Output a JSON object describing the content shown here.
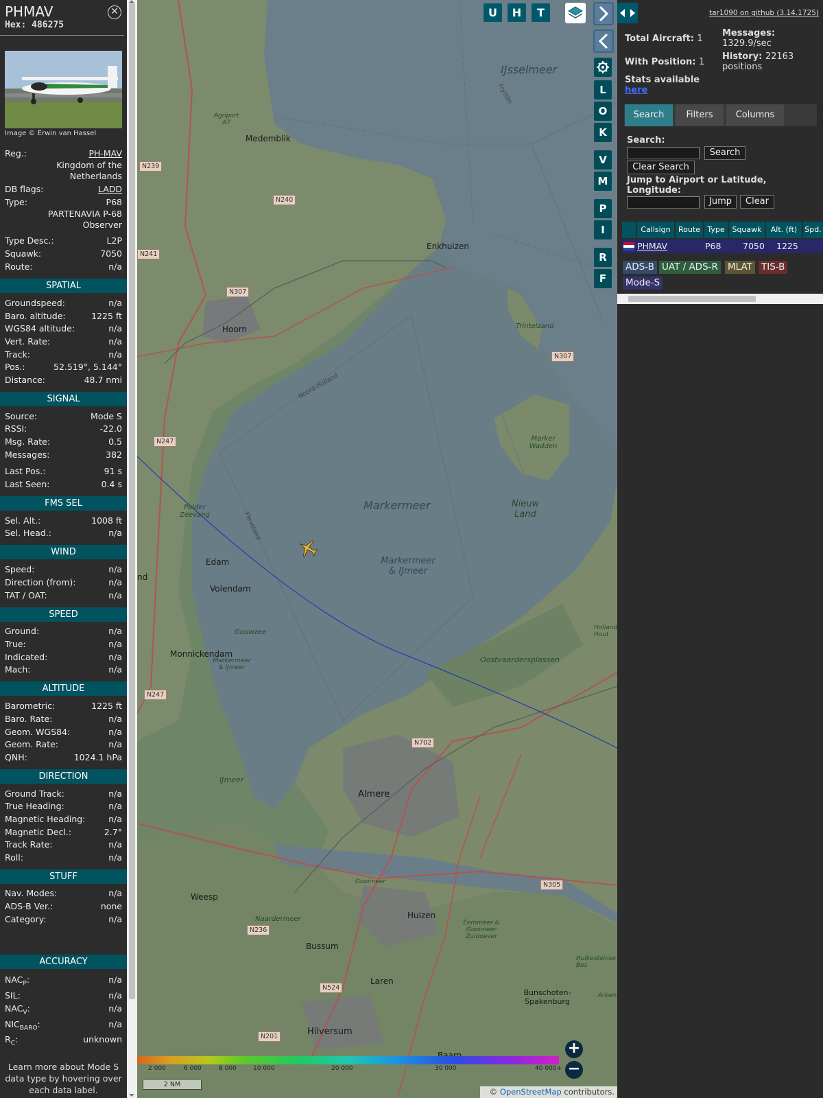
{
  "aircraft": {
    "callsign": "PHMAV",
    "hex_label": "Hex:",
    "hex": "486275",
    "photo_credit": "Image © Erwin van Hassel",
    "reg_label": "Reg.:",
    "reg": "PH-MAV",
    "country": "Kingdom of the Netherlands",
    "dbflags_label": "DB flags:",
    "dbflags": "LADD",
    "type_label": "Type:",
    "type": "P68",
    "type_full": "PARTENAVIA P-68 Observer",
    "typedesc_label": "Type Desc.:",
    "typedesc": "L2P",
    "squawk_label": "Squawk:",
    "squawk": "7050",
    "route_label": "Route:",
    "route": "n/a"
  },
  "spatial": {
    "title": "SPATIAL",
    "rows": [
      {
        "k": "Groundspeed:",
        "v": "n/a"
      },
      {
        "k": "Baro. altitude:",
        "v": "1225 ft"
      },
      {
        "k": "WGS84 altitude:",
        "v": "n/a"
      },
      {
        "k": "Vert. Rate:",
        "v": "n/a"
      },
      {
        "k": "Track:",
        "v": "n/a"
      },
      {
        "k": "Pos.:",
        "v": "52.519°, 5.144°"
      },
      {
        "k": "Distance:",
        "v": "48.7 nmi"
      }
    ]
  },
  "signal": {
    "title": "SIGNAL",
    "rows": [
      {
        "k": "Source:",
        "v": "Mode S"
      },
      {
        "k": "RSSI:",
        "v": "-22.0"
      },
      {
        "k": "Msg. Rate:",
        "v": "0.5"
      },
      {
        "k": "Messages:",
        "v": "382"
      },
      {
        "k": "Last Pos.:",
        "v": "91 s"
      },
      {
        "k": "Last Seen:",
        "v": "0.4 s"
      }
    ]
  },
  "fms": {
    "title": "FMS SEL",
    "rows": [
      {
        "k": "Sel. Alt.:",
        "v": "1008 ft"
      },
      {
        "k": "Sel. Head.:",
        "v": "n/a"
      }
    ]
  },
  "wind": {
    "title": "WIND",
    "rows": [
      {
        "k": "Speed:",
        "v": "n/a"
      },
      {
        "k": "Direction (from):",
        "v": "n/a"
      },
      {
        "k": "TAT / OAT:",
        "v": "n/a"
      }
    ]
  },
  "speed": {
    "title": "SPEED",
    "rows": [
      {
        "k": "Ground:",
        "v": "n/a"
      },
      {
        "k": "True:",
        "v": "n/a"
      },
      {
        "k": "Indicated:",
        "v": "n/a"
      },
      {
        "k": "Mach:",
        "v": "n/a"
      }
    ]
  },
  "altitude": {
    "title": "ALTITUDE",
    "rows": [
      {
        "k": "Barometric:",
        "v": "1225 ft"
      },
      {
        "k": "Baro. Rate:",
        "v": "n/a"
      },
      {
        "k": "Geom. WGS84:",
        "v": "n/a"
      },
      {
        "k": "Geom. Rate:",
        "v": "n/a"
      },
      {
        "k": "QNH:",
        "v": "1024.1 hPa"
      }
    ]
  },
  "direction": {
    "title": "DIRECTION",
    "rows": [
      {
        "k": "Ground Track:",
        "v": "n/a"
      },
      {
        "k": "True Heading:",
        "v": "n/a"
      },
      {
        "k": "Magnetic Heading:",
        "v": "n/a"
      },
      {
        "k": "Magnetic Decl.:",
        "v": "2.7°"
      },
      {
        "k": "Track Rate:",
        "v": "n/a"
      },
      {
        "k": "Roll:",
        "v": "n/a"
      }
    ]
  },
  "stuff": {
    "title": "STUFF",
    "rows": [
      {
        "k": "Nav. Modes:",
        "v": "n/a"
      },
      {
        "k": "ADS-B Ver.:",
        "v": "none"
      },
      {
        "k": "Category:",
        "v": "n/a"
      }
    ]
  },
  "accuracy": {
    "title": "ACCURACY",
    "nacp_main": "NAC",
    "nacp_sub": "P",
    "nacp_v": "n/a",
    "sil_label": "SIL:",
    "sil_v": "n/a",
    "nacv_main": "NAC",
    "nacv_sub": "V",
    "nacv_v": "n/a",
    "nicbaro_main": "NIC",
    "nicbaro_sub": "BARO",
    "nicbaro_v": "n/a",
    "rc_main": "R",
    "rc_sub": "C",
    "rc_v": "unknown",
    "colon": ":"
  },
  "footnote": "Learn more about Mode S data type by hovering over each data label.",
  "map": {
    "top_buttons": [
      "U",
      "H",
      "T"
    ],
    "side_buttons": [
      "L",
      "O",
      "K",
      "V",
      "M",
      "P",
      "I",
      "R",
      "F"
    ],
    "labels": {
      "ijsselmeer": "IJsselmeer",
      "markermeer": "Markermeer",
      "markermeer_ijmeer": "Markermeer & IJmeer",
      "nieuw_land": "Nieuw Land",
      "medemblik": "Medemblik",
      "enkhuizen": "Enkhuizen",
      "hoorn": "Hoorn",
      "edam": "Edam",
      "volendam": "Volendam",
      "monnickendam": "Monnickendam",
      "almere": "Almere",
      "weesp": "Weesp",
      "huizen": "Huizen",
      "bussum": "Bussum",
      "laren": "Laren",
      "hilversum": "Hilversum",
      "baarn": "Baarn",
      "bunschoten": "Bunschoten-Spakenburg",
      "trintelzand": "Trintelzand",
      "marker_wadden": "Marker Wadden",
      "oostvaardersplassen": "Oostvaardersplassen",
      "polder_zeevang": "Polder Zeevang",
      "gouwzee": "Gouwzee",
      "ijmeer": "IJmeer",
      "naardermeer": "Naardermeer",
      "eemmeer": "Eemmeer & Gooimeer Zuidoever",
      "agriport": "Agriport A7",
      "noord_holland": "Noord-Holland",
      "flevoland": "Flevoland",
      "friesland": "Fryslân",
      "hollands_hout": "Hollandse Hout",
      "hulkesteinse_bos": "Hulkesteinse Bos",
      "arkem": "Arkem",
      "gooimeer": "Gooimeer",
      "markermeer_ijmeer_small": "Markermeer & IJmeer",
      "nd": "nd"
    },
    "road_signs": [
      "N239",
      "N240",
      "N241",
      "N307",
      "N307",
      "N247",
      "N247",
      "N702",
      "N305",
      "N236",
      "N524",
      "N201"
    ],
    "colorbar_ticks": [
      "2 000",
      "6 000",
      "8 000",
      "10 000",
      "20 000",
      "30 000",
      "40 000+"
    ],
    "scale": "2 NM",
    "attribution_symbol": "©",
    "attribution_link": "OpenStreetMap",
    "attribution_tail": "contributors."
  },
  "sidebar": {
    "github_link": "tar1090 on github (3.14.1725)",
    "total_aircraft_label": "Total Aircraft:",
    "total_aircraft": "1",
    "with_position_label": "With Position:",
    "with_position": "1",
    "messages_label": "Messages:",
    "messages_rate": "1329.9/sec",
    "history_label": "History:",
    "history_value": "22163",
    "history_unit": "positions",
    "stats_text": "Stats available",
    "stats_link": "here",
    "tabs": [
      "Search",
      "Filters",
      "Columns"
    ],
    "search_label": "Search:",
    "search_button": "Search",
    "clear_search_button": "Clear Search",
    "jump_label": "Jump to Airport or Latitude, Longitude:",
    "jump_button": "Jump",
    "clear_button": "Clear",
    "table_headers": [
      "Callsign",
      "Route",
      "Type",
      "Squawk",
      "Alt. (ft)",
      "Spd."
    ],
    "table_rows": [
      {
        "callsign": "PHMAV",
        "route": "",
        "type": "P68",
        "squawk": "7050",
        "alt": "1225",
        "spd": ""
      }
    ],
    "badges": [
      {
        "label": "ADS-B",
        "color": "#334a6b"
      },
      {
        "label": "UAT / ADS-R",
        "color": "#2e5e3e"
      },
      {
        "label": "MLAT",
        "color": "#5e5530"
      },
      {
        "label": "TIS-B",
        "color": "#6b2e2e"
      },
      {
        "label": "Mode-S",
        "color": "#33336b"
      }
    ]
  }
}
